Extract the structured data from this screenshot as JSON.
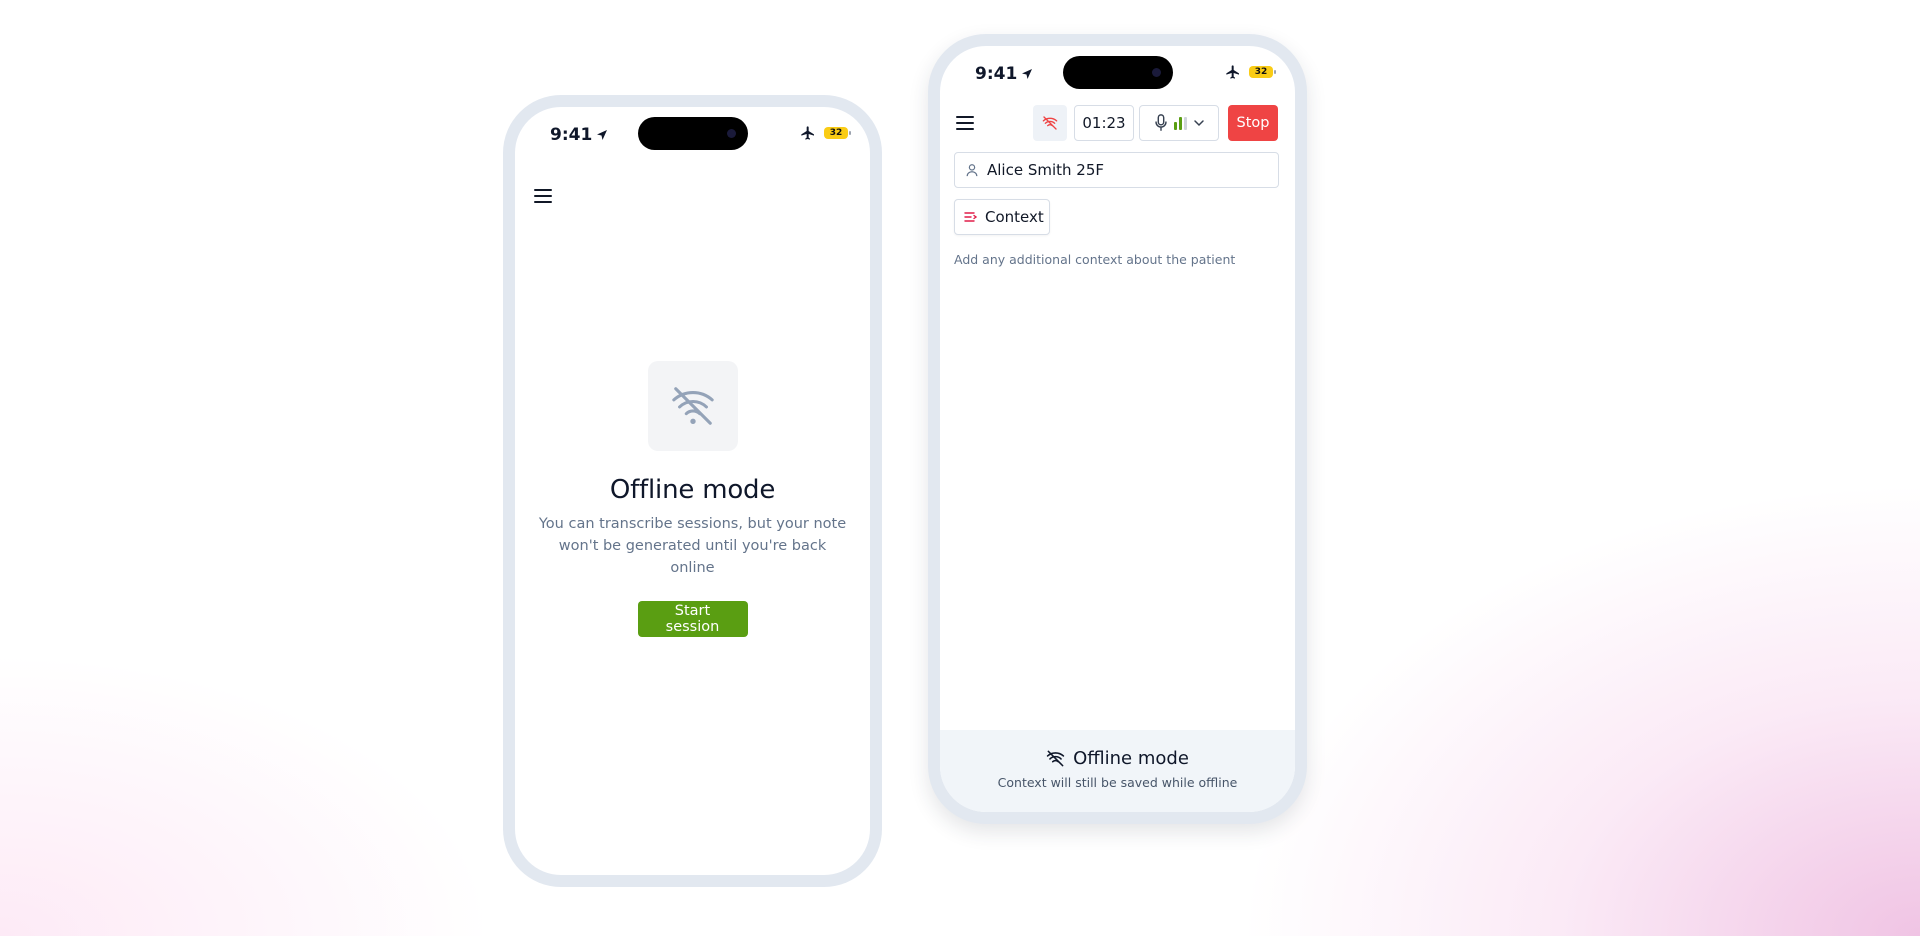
{
  "phone_left": {
    "status_bar": {
      "time": "9:41",
      "battery": "32"
    },
    "empty_state": {
      "icon": "wifi-off-icon",
      "title": "Offline mode",
      "description": "You can transcribe sessions, but your note won't be generated until you're back online",
      "button_label": "Start session"
    }
  },
  "phone_right": {
    "status_bar": {
      "time": "9:41",
      "battery": "32"
    },
    "toolbar": {
      "offline_icon": "wifi-off-icon",
      "timer": "01:23",
      "mic_icon": "microphone-icon",
      "stop_label": "Stop"
    },
    "patient": {
      "value": "Alice Smith 25F"
    },
    "context": {
      "button_label": "Context",
      "placeholder": "Add any additional context about the patient"
    },
    "footer": {
      "title": "Offline mode",
      "subtitle": "Context will still be saved while offline"
    }
  },
  "colors": {
    "primary_green": "#5a9e12",
    "stop_red": "#ef4444",
    "context_accent": "#e11d48",
    "phone_frame": "#e2e8f0"
  }
}
